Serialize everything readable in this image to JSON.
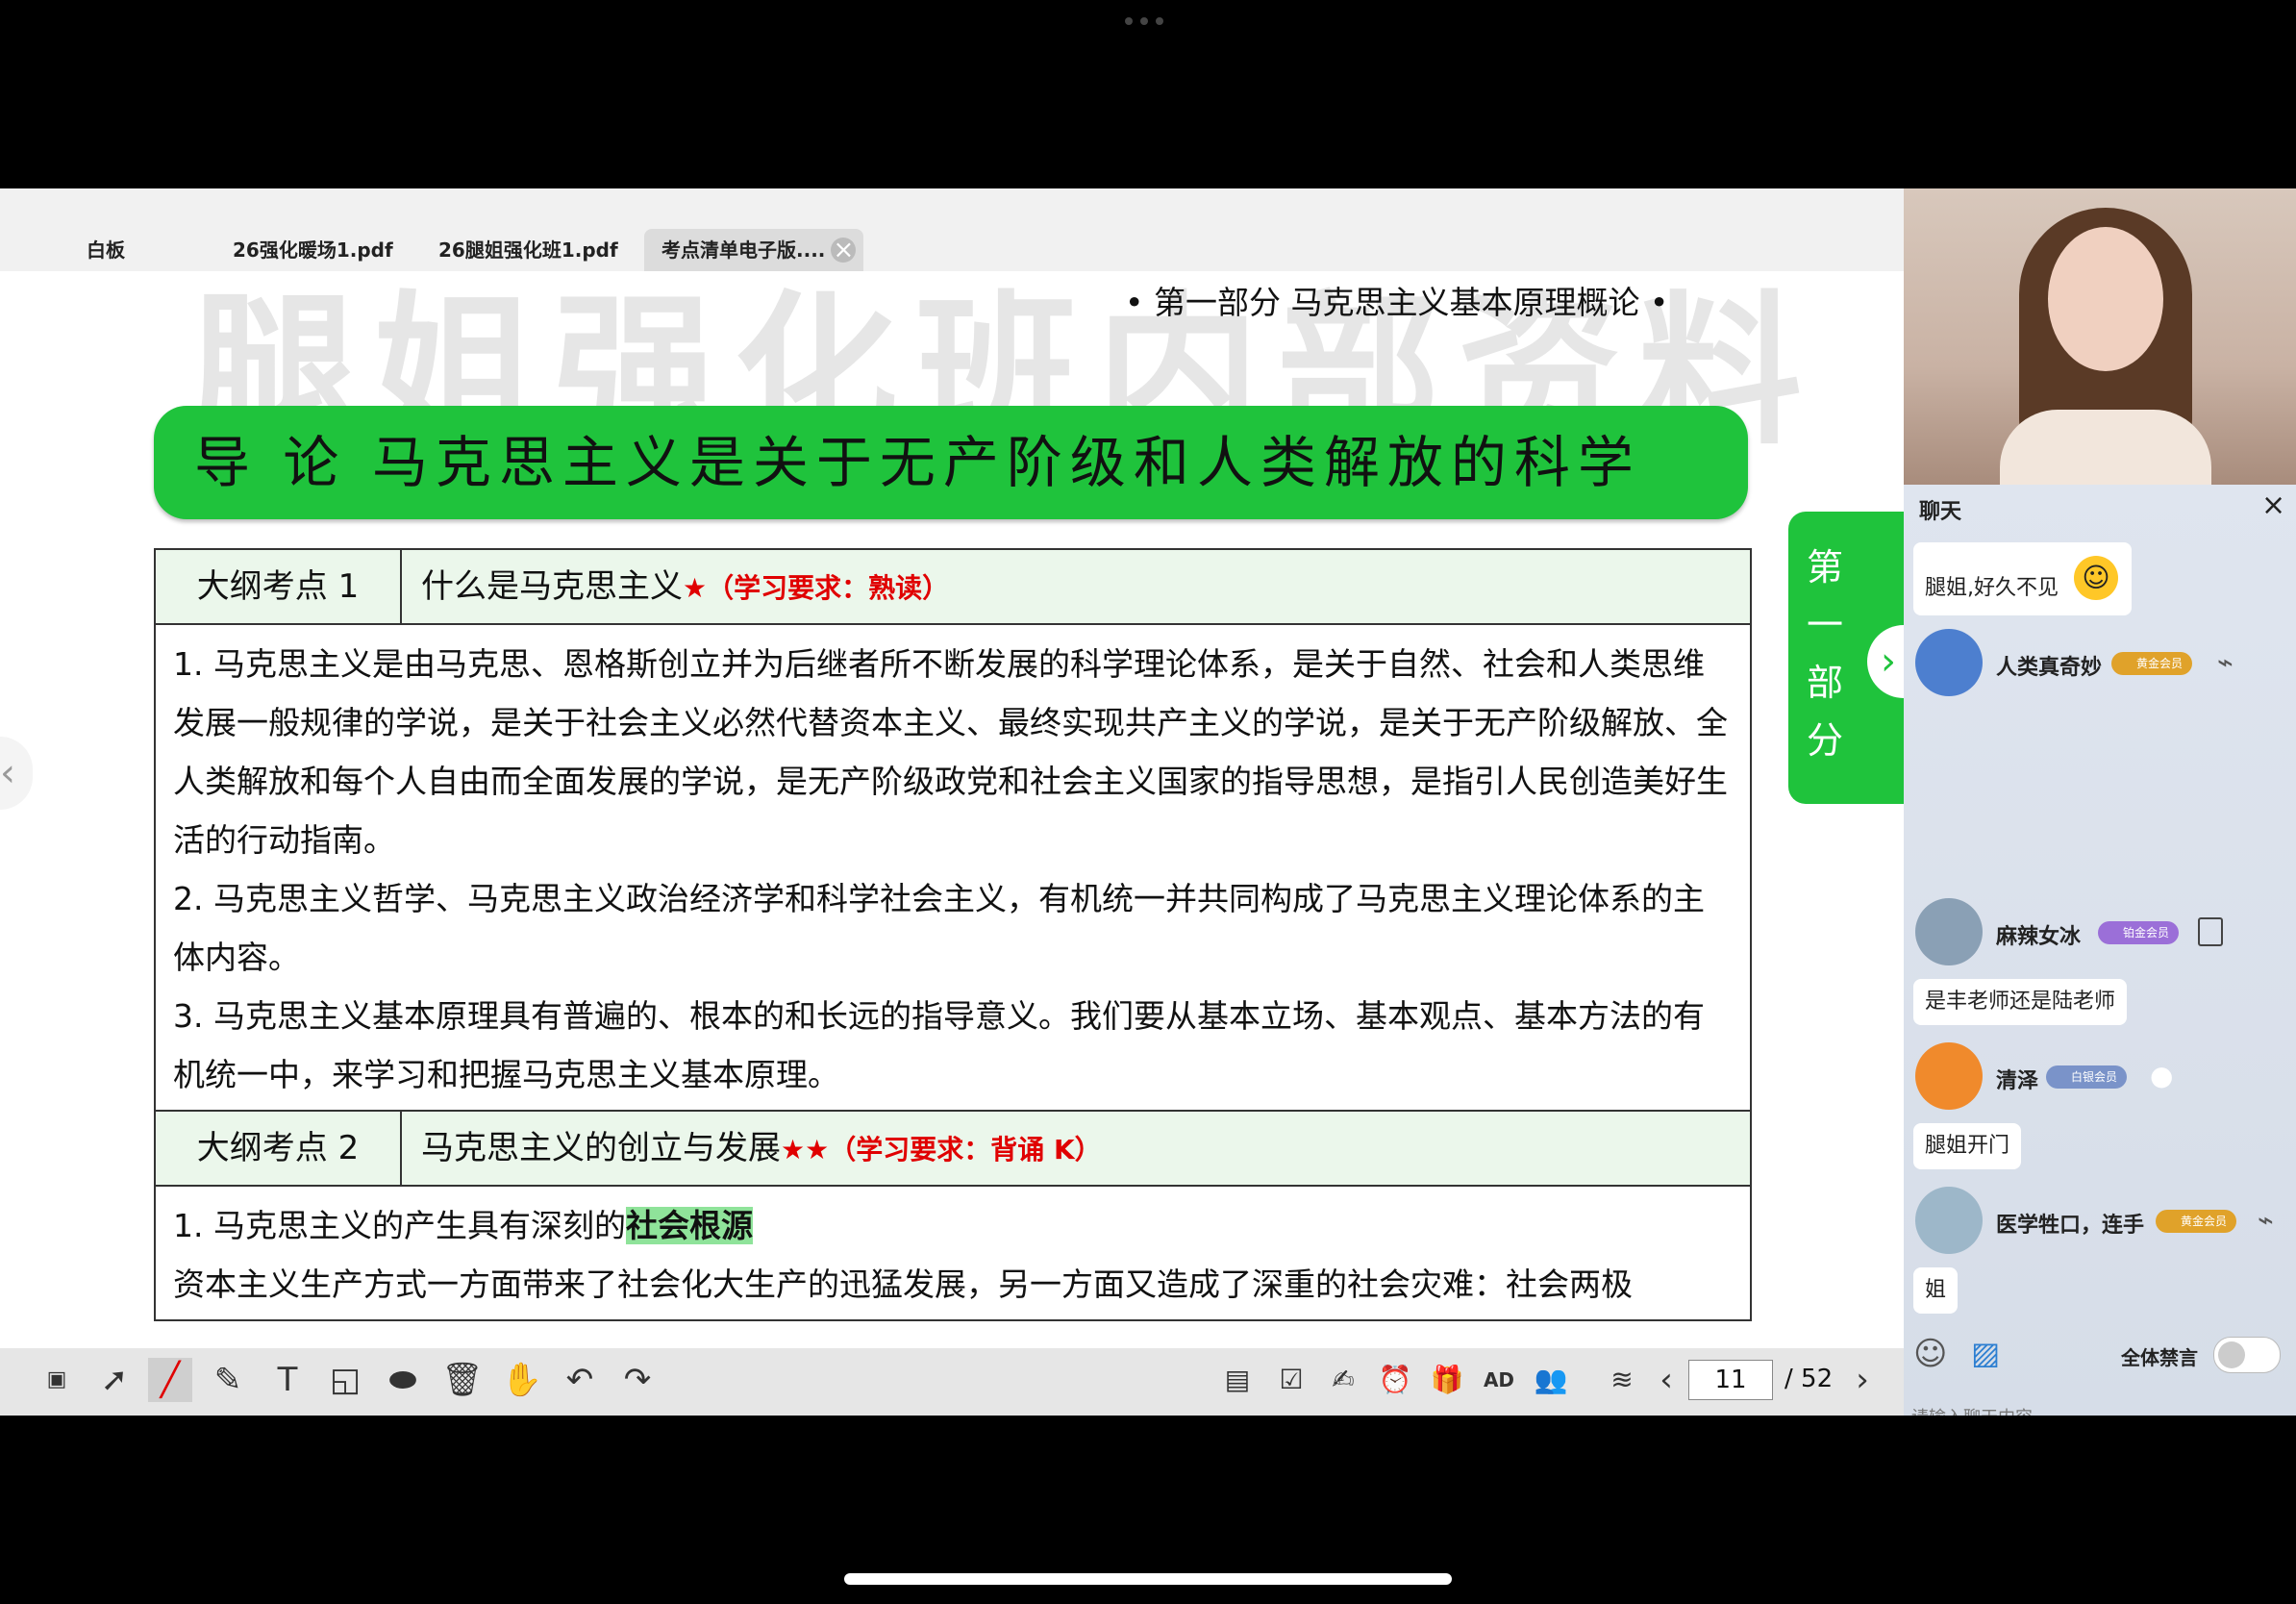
{
  "tabs": [
    "白板",
    "26强化暖场1.pdf",
    "26腿姐强化班1.pdf",
    "考点清单电子版...."
  ],
  "doc": {
    "watermark": "腿姐强化班内部资料",
    "part_heading": "• 第一部分   马克思主义基本原理概论 •",
    "title": "导  论  马克思主义是关于无产阶级和人类解放的科学",
    "side_label": "第一部分",
    "point1": {
      "label": "大纲考点 1",
      "title": "什么是马克思主义",
      "stars": "★",
      "req": "（学习要求：熟读）",
      "paragraphs": [
        "1. 马克思主义是由马克思、恩格斯创立并为后继者所不断发展的科学理论体系，是关于自然、社会和人类思维发展一般规律的学说，是关于社会主义必然代替资本主义、最终实现共产主义的学说，是关于无产阶级解放、全人类解放和每个人自由而全面发展的学说，是无产阶级政党和社会主义国家的指导思想，是指引人民创造美好生活的行动指南。",
        "2. 马克思主义哲学、马克思主义政治经济学和科学社会主义，有机统一并共同构成了马克思主义理论体系的主体内容。",
        "3. 马克思主义基本原理具有普遍的、根本的和长远的指导意义。我们要从基本立场、基本观点、基本方法的有机统一中，来学习和把握马克思主义基本原理。"
      ]
    },
    "point2": {
      "label": "大纲考点 2",
      "title": "马克思主义的创立与发展",
      "stars": "★★",
      "req": "（学习要求：背诵 K）",
      "line1_prefix": "1. 马克思主义的产生具有深刻的",
      "line1_highlight": "社会根源",
      "line2": "资本主义生产方式一方面带来了社会化大生产的迅猛发展，另一方面又造成了深重的社会灾难：社会两极"
    }
  },
  "toolbar": {
    "page_current": "11",
    "page_total": "/ 52",
    "tools": [
      "ppt-icon",
      "pointer-icon",
      "pen-icon",
      "highlighter-icon",
      "text-icon",
      "shape-icon",
      "eraser-icon",
      "delete-icon",
      "hand-icon",
      "undo-icon",
      "redo-icon",
      "quiz-icon",
      "checklist-icon",
      "signature-icon",
      "timer-icon",
      "gift-icon",
      "ad-icon",
      "users-icon",
      "layers-icon"
    ]
  },
  "chat": {
    "title": "聊天",
    "messages": [
      {
        "user": "",
        "text": "腿姐,好久不见"
      },
      {
        "user": "人类真奇妙",
        "badge": "黄金会员",
        "text": ""
      },
      {
        "user": "麻辣女冰",
        "badge": "铂金会员",
        "text": "是丰老师还是陆老师"
      },
      {
        "user": "清泽",
        "badge": "白银会员",
        "text": "腿姐开门"
      },
      {
        "user": "医学牲口，连手",
        "badge": "黄金会员",
        "text": "姐"
      }
    ],
    "mute_label": "全体禁言",
    "input_placeholder": "请输入聊天内容"
  },
  "colors": {
    "accent_green": "#1fc33c",
    "required_red": "#e00000",
    "highlight_green": "#8fe39a"
  }
}
